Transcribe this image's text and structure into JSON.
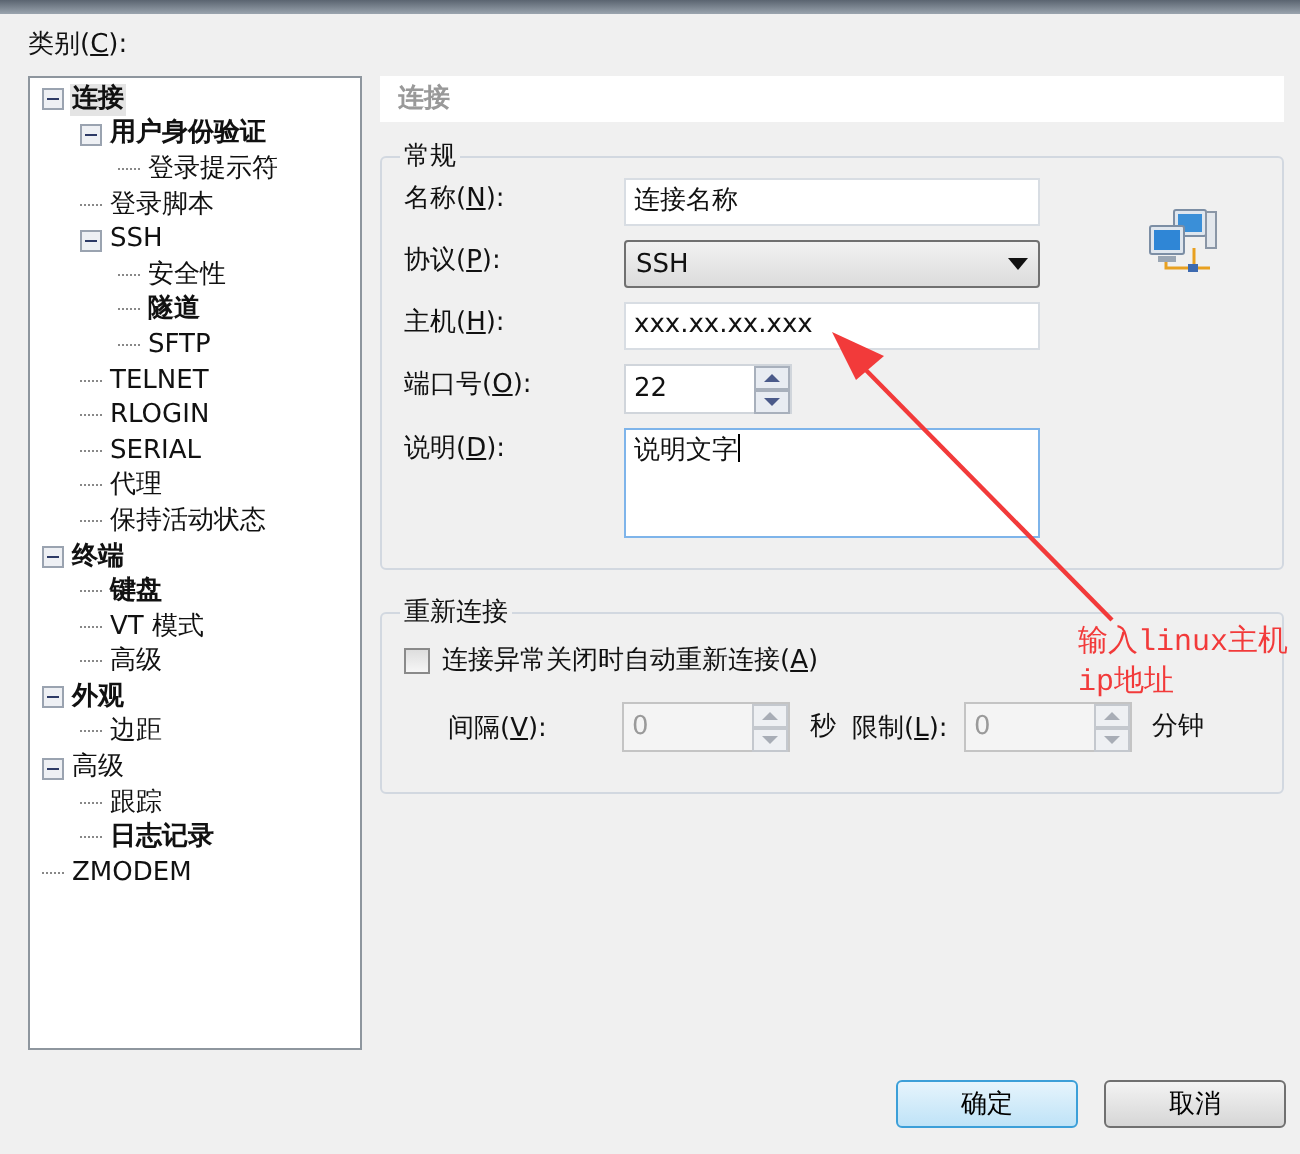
{
  "category_label": {
    "label": "类别(",
    "key": "C",
    "suffix": "):"
  },
  "tree": [
    {
      "label": "连接",
      "bold": true,
      "selected": true,
      "expanded": true,
      "children": [
        {
          "label": "用户身份验证",
          "bold": true,
          "selected": false,
          "expanded": true,
          "children": [
            {
              "label": "登录提示符",
              "bold": false,
              "selected": false
            }
          ]
        },
        {
          "label": "登录脚本",
          "bold": false,
          "selected": false
        },
        {
          "label": "SSH",
          "bold": false,
          "selected": false,
          "expanded": true,
          "children": [
            {
              "label": "安全性",
              "bold": false,
              "selected": false
            },
            {
              "label": "隧道",
              "bold": true,
              "selected": false
            },
            {
              "label": "SFTP",
              "bold": false,
              "selected": false
            }
          ]
        },
        {
          "label": "TELNET",
          "bold": false,
          "selected": false
        },
        {
          "label": "RLOGIN",
          "bold": false,
          "selected": false
        },
        {
          "label": "SERIAL",
          "bold": false,
          "selected": false
        },
        {
          "label": "代理",
          "bold": false,
          "selected": false
        },
        {
          "label": "保持活动状态",
          "bold": false,
          "selected": false
        }
      ]
    },
    {
      "label": "终端",
      "bold": true,
      "selected": false,
      "expanded": true,
      "children": [
        {
          "label": "键盘",
          "bold": true,
          "selected": false
        },
        {
          "label": "VT 模式",
          "bold": false,
          "selected": false
        },
        {
          "label": "高级",
          "bold": false,
          "selected": false
        }
      ]
    },
    {
      "label": "外观",
      "bold": true,
      "selected": false,
      "expanded": true,
      "children": [
        {
          "label": "边距",
          "bold": false,
          "selected": false
        }
      ]
    },
    {
      "label": "高级",
      "bold": false,
      "selected": false,
      "expanded": true,
      "children": [
        {
          "label": "跟踪",
          "bold": false,
          "selected": false
        },
        {
          "label": "日志记录",
          "bold": true,
          "selected": false
        }
      ]
    },
    {
      "label": "ZMODEM",
      "bold": false,
      "selected": false
    }
  ],
  "panel_title": "连接",
  "general": {
    "title": "常规",
    "fields": [
      {
        "kind": "text",
        "label": "名称(",
        "key": "N",
        "suffix": "):",
        "value": "连接名称"
      },
      {
        "kind": "dropdown",
        "label": "协议(",
        "key": "P",
        "suffix": "):",
        "value": "SSH"
      },
      {
        "kind": "text",
        "label": "主机(",
        "key": "H",
        "suffix": "):",
        "value": "xxx.xx.xx.xxx"
      },
      {
        "kind": "spin",
        "label": "端口号(",
        "key": "O",
        "suffix": "):",
        "value": "22"
      },
      {
        "kind": "textarea",
        "label": "说明(",
        "key": "D",
        "suffix": "):",
        "value": "说明文字"
      }
    ]
  },
  "reconnect": {
    "title": "重新连接",
    "checkbox": {
      "label": "连接异常关闭时自动重新连接(",
      "key": "A",
      "suffix": ")",
      "checked": false
    },
    "interval": {
      "label": "间隔(",
      "key": "V",
      "suffix": "):",
      "value": "0",
      "unit": "秒",
      "disabled": true
    },
    "limit": {
      "label": "限制(",
      "key": "L",
      "suffix": "):",
      "value": "0",
      "unit": "分钟",
      "disabled": true
    }
  },
  "annotation": {
    "lines": [
      "输入linux主机",
      "ip地址"
    ]
  },
  "buttons": [
    {
      "label": "确定",
      "default": true
    },
    {
      "label": "取消",
      "default": false
    }
  ]
}
